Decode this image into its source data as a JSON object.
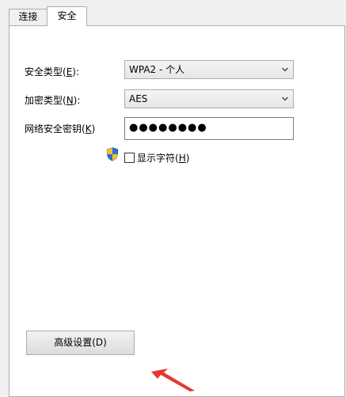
{
  "tabs": {
    "connection": "连接",
    "security": "安全"
  },
  "security_type": {
    "label_prefix": "安全类型(",
    "label_key": "E",
    "label_suffix": "):",
    "value": "WPA2 - 个人"
  },
  "encryption_type": {
    "label_prefix": "加密类型(",
    "label_key": "N",
    "label_suffix": "):",
    "value": "AES"
  },
  "network_key": {
    "label_prefix": "网络安全密钥(",
    "label_key": "K",
    "label_suffix": ")",
    "value": "●●●●●●●●"
  },
  "show_characters": {
    "label_prefix": "显示字符(",
    "label_key": "H",
    "label_suffix": ")",
    "checked": false
  },
  "advanced_button": {
    "label": "高级设置(D)"
  },
  "icons": {
    "shield": "uac-shield-icon",
    "dropdown": "chevron-down-icon",
    "annotation": "red-arrow-annotation"
  },
  "colors": {
    "annotation_arrow": "#e53935"
  }
}
